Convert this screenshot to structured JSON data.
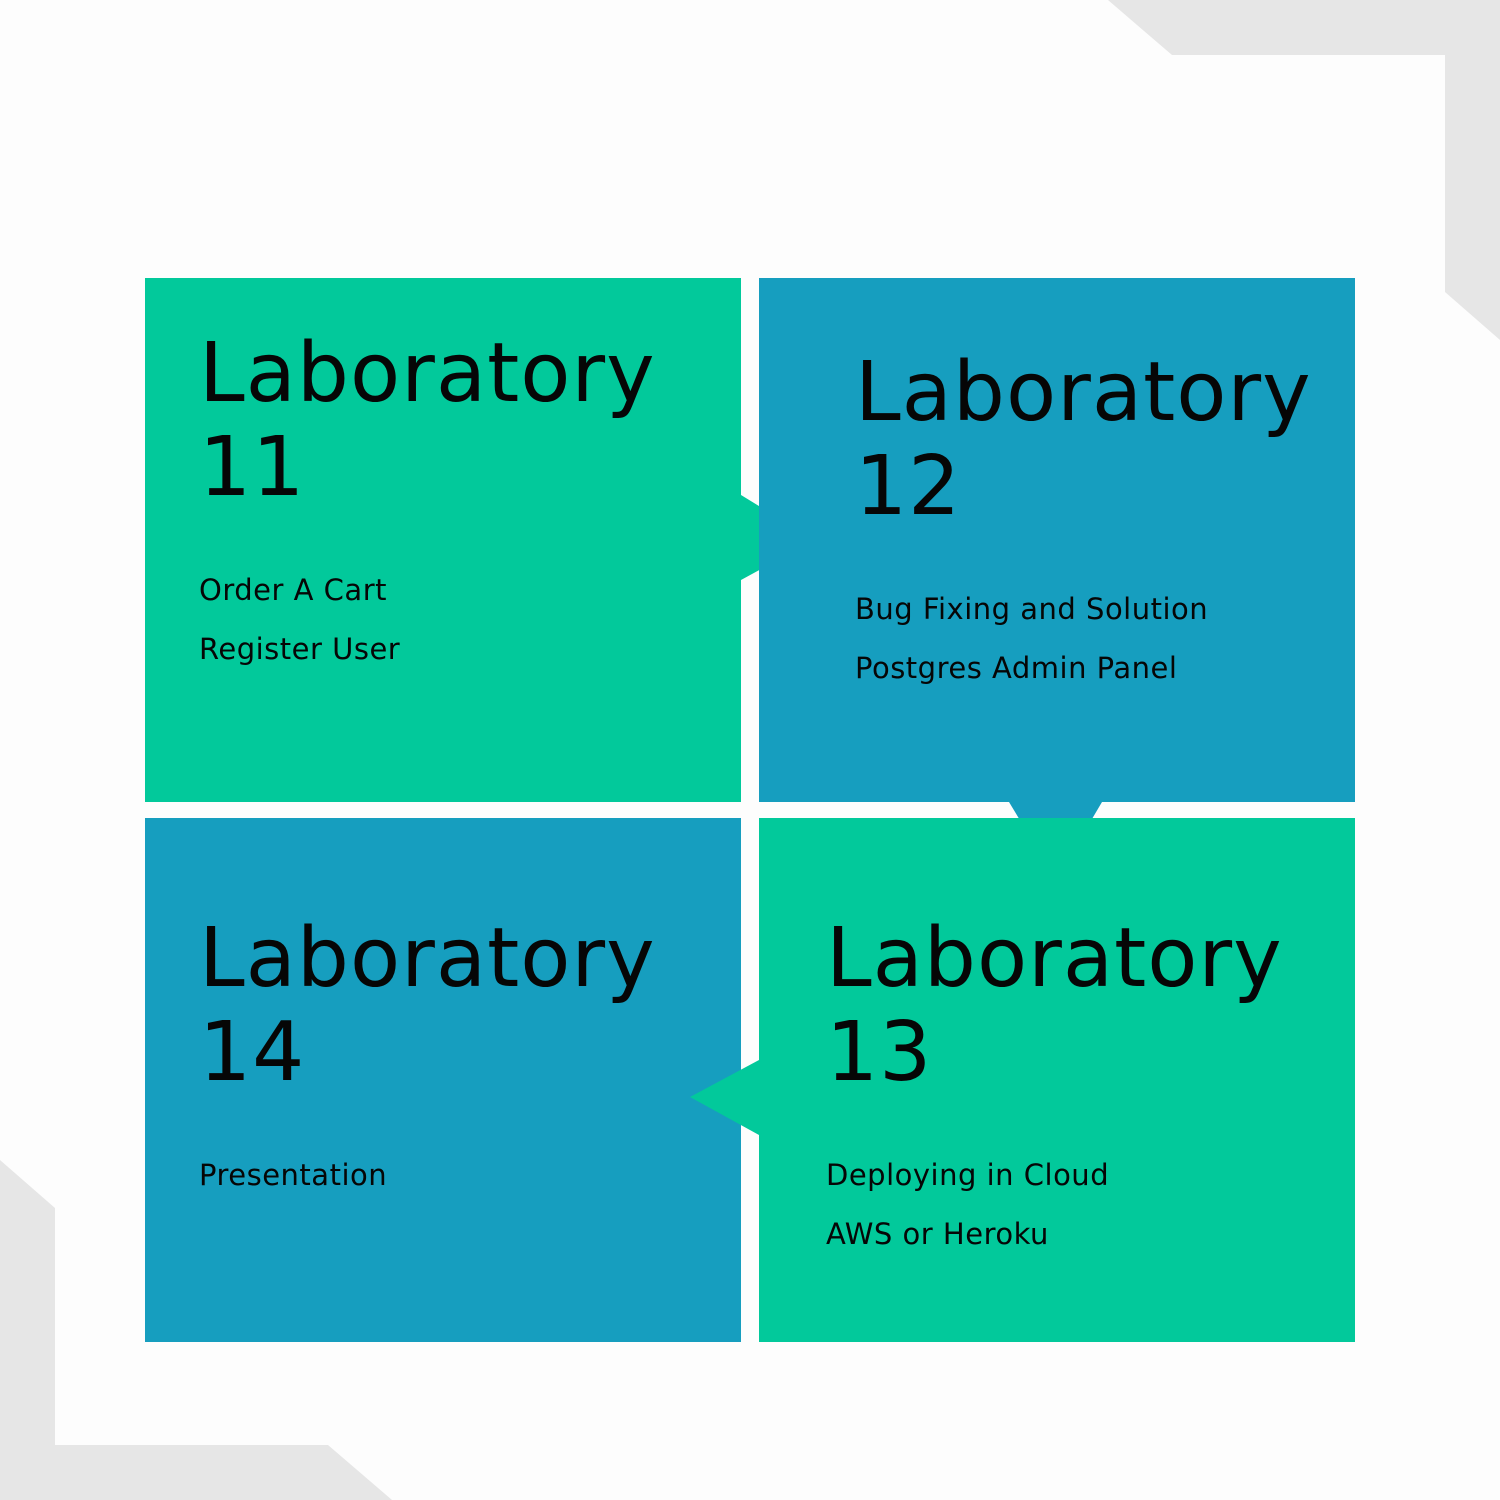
{
  "colors": {
    "background": "#fdfdfd",
    "corner_gray": "#e6e6e6",
    "green": "#02c99b",
    "blue": "#169ebf",
    "text": "#060606"
  },
  "labs": {
    "lab11": {
      "title": "Laboratory",
      "number": "11",
      "items": [
        "Order A Cart",
        "Register User"
      ]
    },
    "lab12": {
      "title": "Laboratory",
      "number": "12",
      "items": [
        "Bug Fixing and Solution",
        "Postgres Admin Panel"
      ]
    },
    "lab13": {
      "title": "Laboratory",
      "number": "13",
      "items": [
        "Deploying in Cloud",
        "AWS or Heroku"
      ]
    },
    "lab14": {
      "title": "Laboratory",
      "number": "14",
      "items": [
        "Presentation"
      ]
    }
  }
}
